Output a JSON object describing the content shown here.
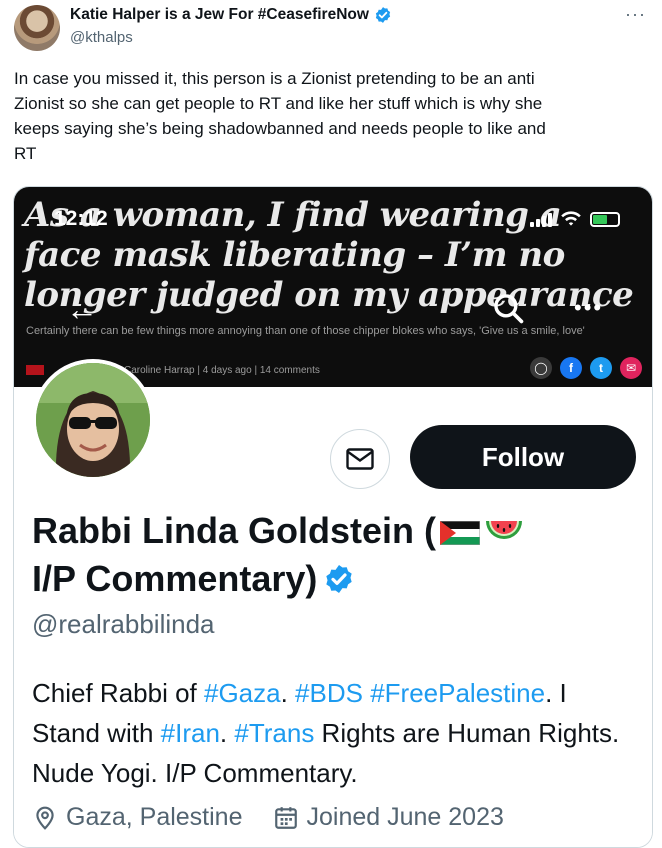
{
  "tweet": {
    "author_name": "Katie Halper is a Jew For #CeasefireNow",
    "author_handle": "@kthalps",
    "more_label": "···",
    "text": "In case you missed it, this person is a Zionist pretending to be an anti\nZionist so she can get people to RT and like her stuff which is why she\nkeeps saying she’s being shadowbanned and needs people to like and\nRT"
  },
  "screenshot": {
    "status_time": "12:12",
    "headline": "As a woman, I find wearing a face mask liberating – I’m no longer judged on my appearance",
    "subhead": "Certainly there can be few things more annoying than one of those chipper blokes who says, 'Give us a smile, love'",
    "byline": "Caroline Harrap | 4 days ago | 14 comments",
    "back_glyph": "←",
    "more_glyph": "•••",
    "share_icons": [
      {
        "name": "comment",
        "glyph": "◯",
        "color": "#3a3a3a"
      },
      {
        "name": "facebook",
        "glyph": "f",
        "color": "#1877f2"
      },
      {
        "name": "twitter",
        "glyph": "t",
        "color": "#1d9bf0"
      },
      {
        "name": "email",
        "glyph": "✉",
        "color": "#e0245e"
      }
    ],
    "profile": {
      "follow_label": "Follow",
      "display_name_line1": "Rabbi Linda Goldstein (",
      "display_name_line2": "I/P Commentary)",
      "handle": "@realrabbilinda",
      "bio_parts": [
        {
          "text": "Chief Rabbi of ",
          "link": false
        },
        {
          "text": "#Gaza",
          "link": true
        },
        {
          "text": ". ",
          "link": false
        },
        {
          "text": "#BDS",
          "link": true
        },
        {
          "text": " ",
          "link": false
        },
        {
          "text": "#FreePalestine",
          "link": true
        },
        {
          "text": ". I Stand with ",
          "link": false
        },
        {
          "text": "#Iran",
          "link": true
        },
        {
          "text": ". ",
          "link": false
        },
        {
          "text": "#Trans",
          "link": true
        },
        {
          "text": " Rights are Human Rights. Nude Yogi. I/P Commentary.",
          "link": false
        }
      ],
      "location": "Gaza, Palestine",
      "joined": "Joined June 2023"
    }
  },
  "colors": {
    "accent": "#1d9bf0",
    "text": "#0f1419",
    "muted": "#536471",
    "follow_bg": "#0f1419"
  }
}
